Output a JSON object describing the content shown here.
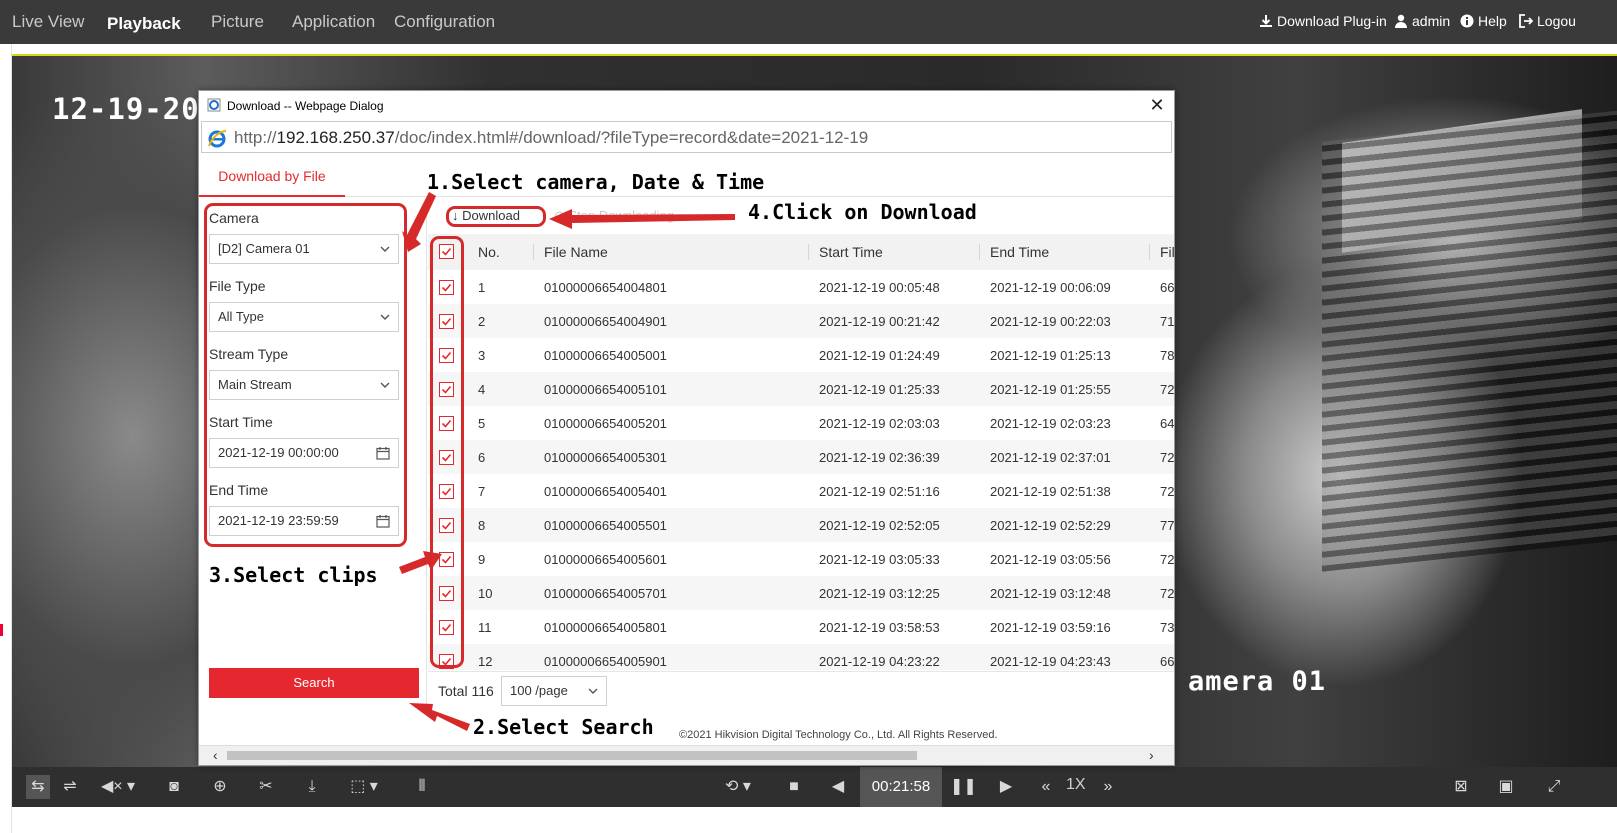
{
  "nav": {
    "items": [
      "Live View",
      "Playback",
      "Picture",
      "Application",
      "Configuration"
    ],
    "active": "Playback",
    "right": {
      "download_plugin": "Download Plug-in",
      "user": "admin",
      "help": "Help",
      "logout": "Logou"
    }
  },
  "video": {
    "osd_date": "12-19-20",
    "osd_camera": "amera 01"
  },
  "dialog": {
    "title": "Download -- Webpage Dialog",
    "url_prefix": "http://",
    "url_host": "192.168.250.37",
    "url_path": "/doc/index.html#/download/?fileType=record&date=2021-12-19",
    "tab": "Download by File",
    "form": {
      "camera_label": "Camera",
      "camera_value": "[D2] Camera 01",
      "filetype_label": "File Type",
      "filetype_value": "All Type",
      "stream_label": "Stream Type",
      "stream_value": "Main Stream",
      "start_label": "Start Time",
      "start_value": "2021-12-19 00:00:00",
      "end_label": "End Time",
      "end_value": "2021-12-19 23:59:59",
      "search_button": "Search"
    },
    "actions": {
      "download": "Download",
      "stop": "Stop Downloading"
    },
    "table": {
      "headers": [
        "No.",
        "File Name",
        "Start Time",
        "End Time",
        "Fil"
      ],
      "rows": [
        [
          "1",
          "01000006654004801",
          "2021-12-19 00:05:48",
          "2021-12-19 00:06:09",
          "66"
        ],
        [
          "2",
          "01000006654004901",
          "2021-12-19 00:21:42",
          "2021-12-19 00:22:03",
          "71"
        ],
        [
          "3",
          "01000006654005001",
          "2021-12-19 01:24:49",
          "2021-12-19 01:25:13",
          "78"
        ],
        [
          "4",
          "01000006654005101",
          "2021-12-19 01:25:33",
          "2021-12-19 01:25:55",
          "72"
        ],
        [
          "5",
          "01000006654005201",
          "2021-12-19 02:03:03",
          "2021-12-19 02:03:23",
          "64"
        ],
        [
          "6",
          "01000006654005301",
          "2021-12-19 02:36:39",
          "2021-12-19 02:37:01",
          "72"
        ],
        [
          "7",
          "01000006654005401",
          "2021-12-19 02:51:16",
          "2021-12-19 02:51:38",
          "72"
        ],
        [
          "8",
          "01000006654005501",
          "2021-12-19 02:52:05",
          "2021-12-19 02:52:29",
          "77"
        ],
        [
          "9",
          "01000006654005601",
          "2021-12-19 03:05:33",
          "2021-12-19 03:05:56",
          "72"
        ],
        [
          "10",
          "01000006654005701",
          "2021-12-19 03:12:25",
          "2021-12-19 03:12:48",
          "72"
        ],
        [
          "11",
          "01000006654005801",
          "2021-12-19 03:58:53",
          "2021-12-19 03:59:16",
          "73"
        ],
        [
          "12",
          "01000006654005901",
          "2021-12-19 04:23:22",
          "2021-12-19 04:23:43",
          "66"
        ]
      ]
    },
    "footer": {
      "total": "Total 116",
      "page_size": "100 /page"
    },
    "copyright": "©2021 Hikvision Digital Technology Co., Ltd. All Rights Reserved."
  },
  "annotations": {
    "step1": "1.Select camera, Date & Time",
    "step2": "2.Select Search",
    "step3": "3.Select clips",
    "step4": "4.Click on Download"
  },
  "playback": {
    "time": "00:21:58",
    "speed": "1X"
  },
  "colors": {
    "accent": "#e5282f",
    "annotation": "#d62a2a",
    "nav_bg": "#3a3a3a"
  }
}
